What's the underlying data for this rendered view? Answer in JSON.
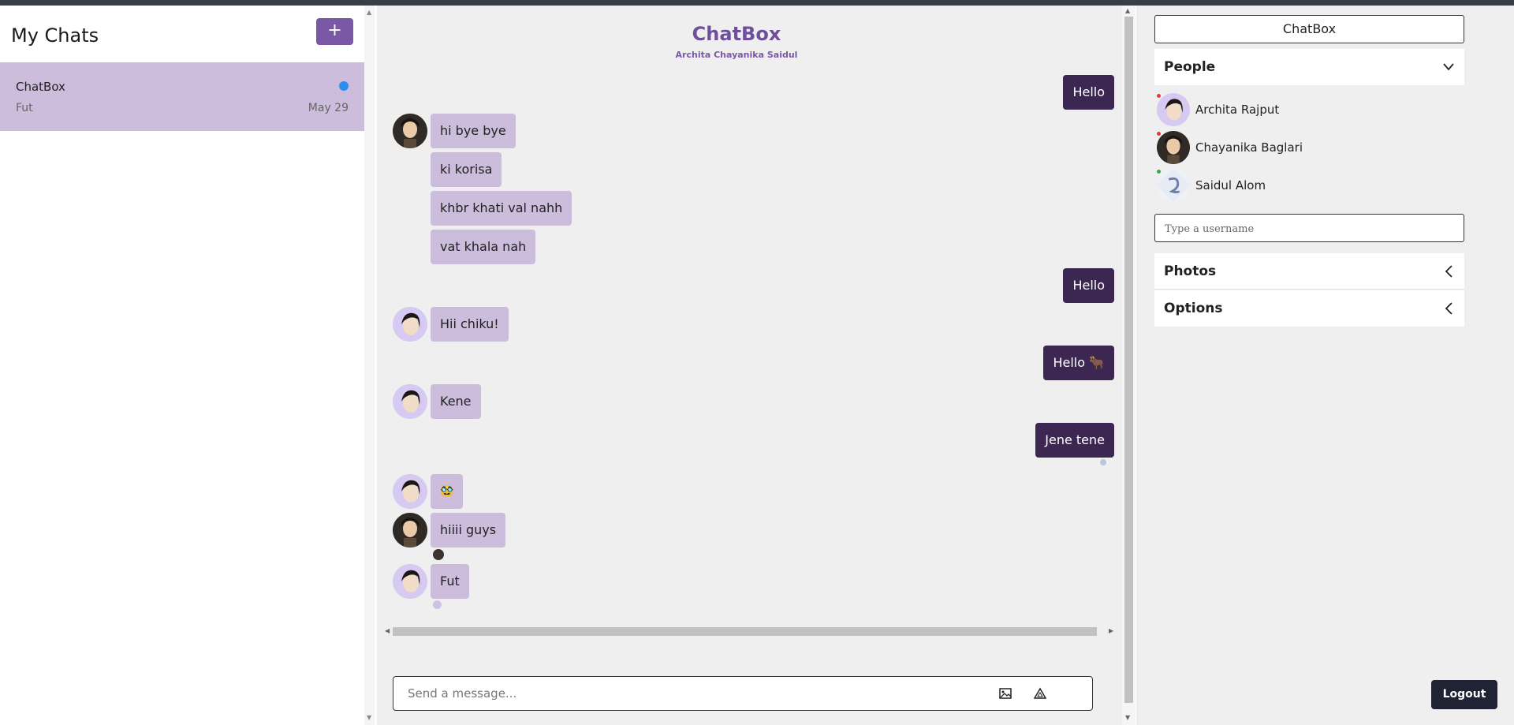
{
  "left": {
    "title": "My Chats",
    "add_label": "+",
    "chats": [
      {
        "name": "ChatBox",
        "last_message": "Fut",
        "date": "May 29",
        "unread": true
      }
    ]
  },
  "main": {
    "title": "ChatBox",
    "subtitle": "Archita Chayanika Saidul",
    "messages": [
      {
        "text": "Hello",
        "direction": "out"
      },
      {
        "text": "hi bye bye",
        "direction": "in",
        "sender": "Chayanika Baglari"
      },
      {
        "text": "ki korisa",
        "direction": "in"
      },
      {
        "text": "khbr khati val nahh",
        "direction": "in"
      },
      {
        "text": "vat khala nah",
        "direction": "in"
      },
      {
        "text": "Hello",
        "direction": "out"
      },
      {
        "text": "Hii chiku!",
        "direction": "in",
        "sender": "Archita Rajput"
      },
      {
        "text": "Hello 🐂",
        "direction": "out"
      },
      {
        "text": "Kene",
        "direction": "in",
        "sender": "Archita Rajput"
      },
      {
        "text": "Jene tene",
        "direction": "out"
      },
      {
        "text": "🥸",
        "direction": "in",
        "sender": "Archita Rajput"
      },
      {
        "text": "hiiii guys",
        "direction": "in",
        "sender": "Chayanika Baglari"
      },
      {
        "text": "Fut",
        "direction": "in",
        "sender": "Archita Rajput"
      }
    ],
    "composer": {
      "placeholder": "Send a message..."
    }
  },
  "sidebar": {
    "title": "ChatBox",
    "people_label": "People",
    "people": [
      {
        "name": "Archita Rajput",
        "status_color": "#e53935"
      },
      {
        "name": "Chayanika Baglari",
        "status_color": "#e53935"
      },
      {
        "name": "Saidul Alom",
        "status_color": "#43a047"
      }
    ],
    "username_placeholder": "Type a username",
    "photos_label": "Photos",
    "options_label": "Options",
    "logout_label": "Logout"
  },
  "colors": {
    "accent": "#7b58a6",
    "outgoing_bubble": "#3b2752",
    "incoming_bubble": "#cbbddb",
    "unread_dot": "#2d8cf0"
  }
}
